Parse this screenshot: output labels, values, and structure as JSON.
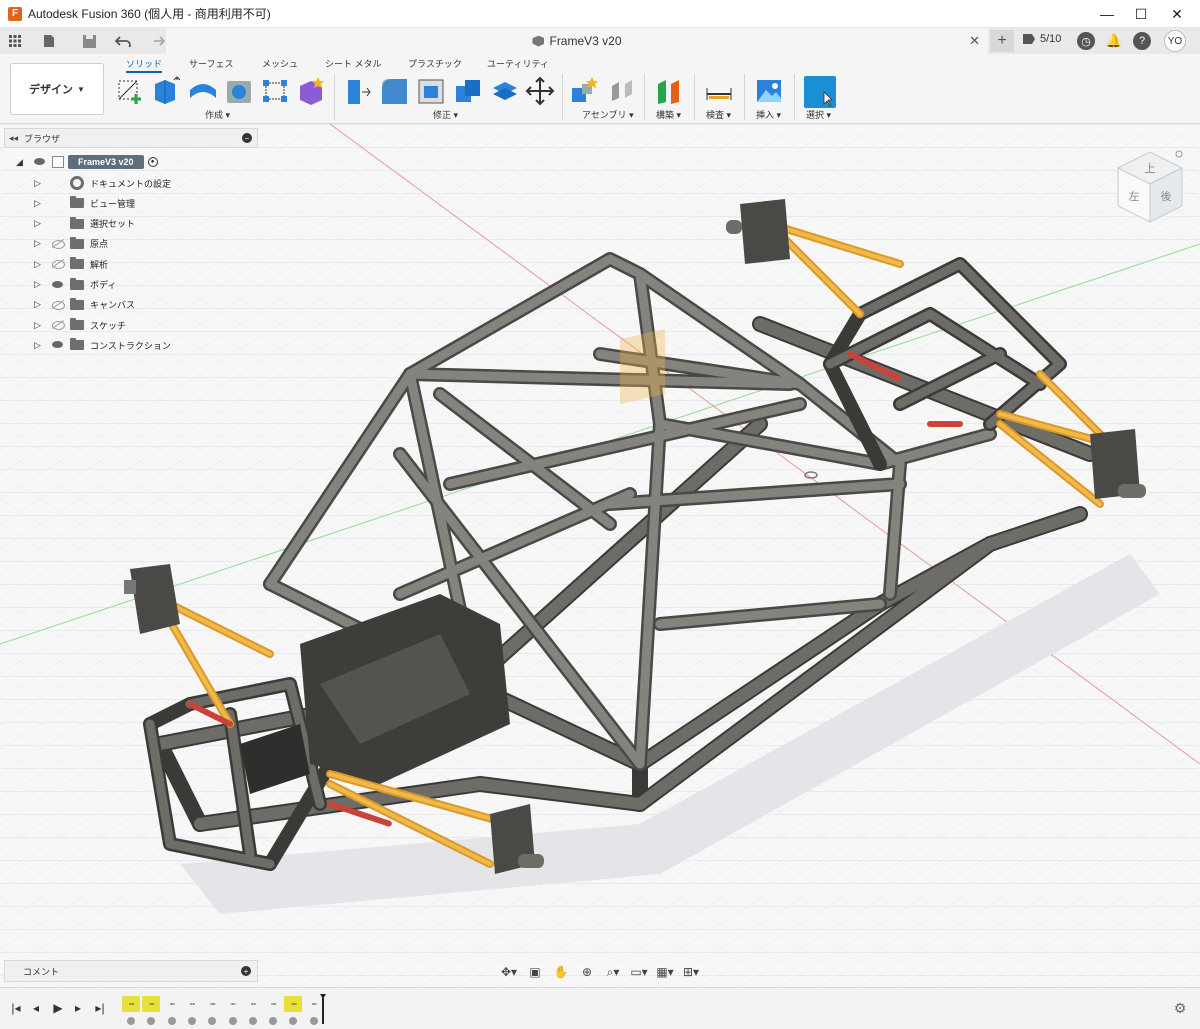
{
  "window": {
    "title": "Autodesk Fusion 360 (個人用 - 商用利用不可)",
    "app_icon_letter": "F",
    "minimize": "—",
    "maximize": "☐",
    "close": "✕"
  },
  "tabbar": {
    "doc_title": "FrameV3 v20",
    "tab_close": "✕",
    "new_tab": "+",
    "jobs": "5/10",
    "avatar": "YO",
    "icons": [
      "grid-icon",
      "file-icon",
      "save-icon",
      "undo-icon",
      "redo-icon",
      "jobs-icon",
      "clock-icon",
      "bell-icon",
      "help-icon"
    ]
  },
  "ribbon": {
    "workspace": "デザイン",
    "tabs": [
      "ソリッド",
      "サーフェス",
      "メッシュ",
      "シート メタル",
      "プラスチック",
      "ユーティリティ"
    ],
    "active_tab": "ソリッド",
    "groups": [
      "作成",
      "修正",
      "アセンブリ",
      "構築",
      "検査",
      "挿入",
      "選択"
    ],
    "colors": {
      "accent_blue": "#0a64b4",
      "select_blue": "#1a8fd4",
      "tool_blue": "#2b82d9",
      "tool_purple": "#8b5cd6"
    }
  },
  "browser": {
    "title": "ブラウザ",
    "collapse": "◂◂",
    "close": "−",
    "root": "FrameV3 v20",
    "items": [
      {
        "label": "ドキュメントの設定",
        "icon": "gear-icon",
        "eye": "none"
      },
      {
        "label": "ビュー管理",
        "icon": "folder-icon",
        "eye": "none"
      },
      {
        "label": "選択セット",
        "icon": "folder-icon",
        "eye": "none"
      },
      {
        "label": "原点",
        "icon": "folder-icon",
        "eye": "hidden"
      },
      {
        "label": "解析",
        "icon": "folder-icon",
        "eye": "hidden"
      },
      {
        "label": "ボディ",
        "icon": "folder-icon",
        "eye": "visible"
      },
      {
        "label": "キャンバス",
        "icon": "folder-icon",
        "eye": "hidden"
      },
      {
        "label": "スケッチ",
        "icon": "folder-icon",
        "eye": "hidden"
      },
      {
        "label": "コンストラクション",
        "icon": "folder-icon",
        "eye": "visible"
      }
    ]
  },
  "viewcube": {
    "top_face": "上",
    "front_face": "左",
    "right_face": "後"
  },
  "comments": {
    "label": "コメント",
    "add": "+"
  },
  "navbar": {
    "icons": [
      "orbit-icon",
      "look-at-icon",
      "pan-icon",
      "zoom-icon",
      "fit-icon",
      "display-icon",
      "grid-icon",
      "viewports-icon"
    ]
  },
  "timeline": {
    "controls": [
      "|◂",
      "◂",
      "▶",
      "▸",
      "▸|"
    ],
    "features": [
      "▫▫▫",
      "▫▫▫",
      "▫▫▫",
      "▫▫▫",
      "▫▫▫",
      "▫▫▫",
      "▫▫▫",
      "▫▫▫",
      "▫▫▫",
      "▫▫▫"
    ],
    "highlighted": [
      0,
      1,
      8
    ],
    "settings": "⚙"
  }
}
